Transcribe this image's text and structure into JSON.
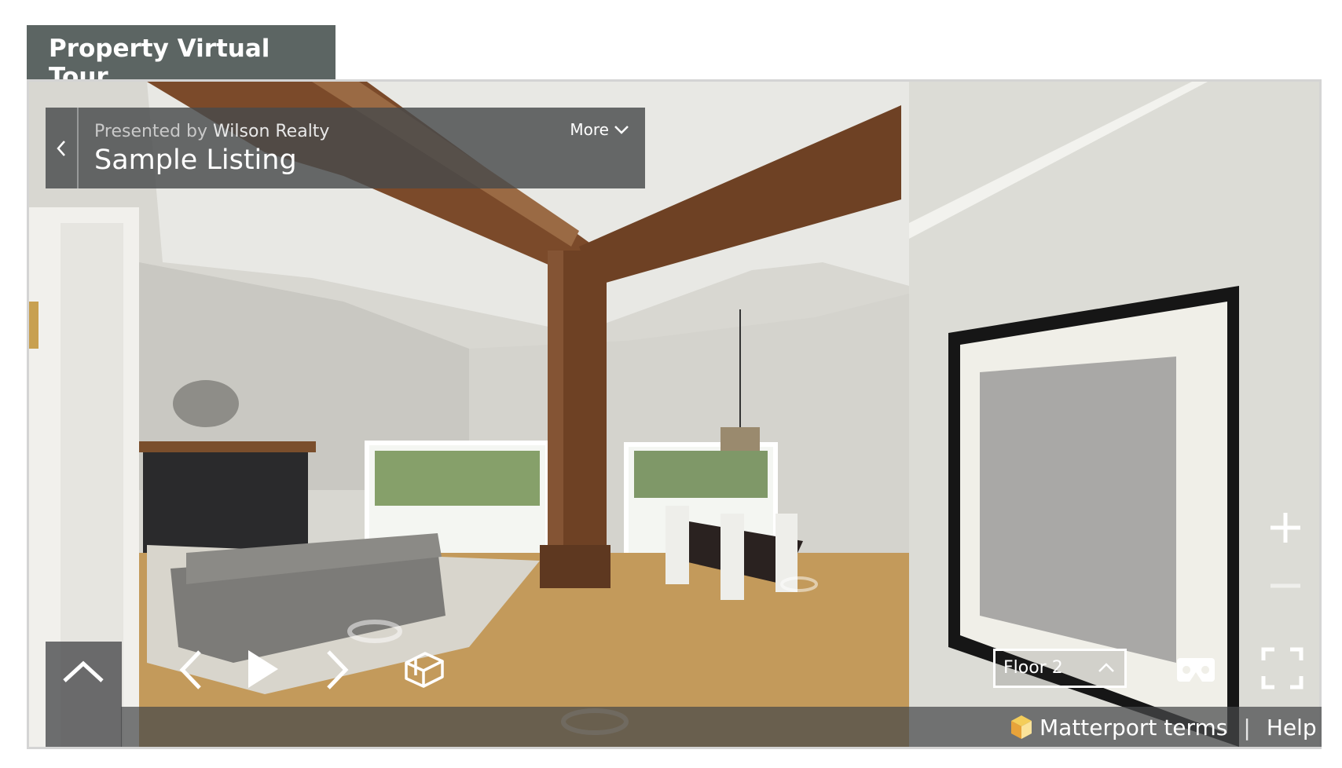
{
  "title": "Property Virtual Tour",
  "header": {
    "presented_prefix": "Presented by",
    "presenter": "Wilson Realty",
    "listing_name": "Sample Listing",
    "more_label": "More"
  },
  "floor": {
    "selected": "Floor 2"
  },
  "footer": {
    "terms_label": "Matterport terms",
    "separator": "|",
    "help_label": "Help"
  },
  "icons": {
    "back": "chevron-left-icon",
    "more": "chevron-down-icon",
    "expand": "chevron-up-icon",
    "prev": "chevron-left-icon",
    "play": "play-icon",
    "next": "chevron-right-icon",
    "dollhouse": "dollhouse-icon",
    "zoom_in": "plus-icon",
    "zoom_out": "minus-icon",
    "vr": "vr-headset-icon",
    "fullscreen": "fullscreen-icon",
    "logo": "matterport-logo-icon"
  },
  "colors": {
    "title_bg": "#5c6563",
    "overlay_bg": "#484a4c",
    "text": "#ffffff"
  }
}
